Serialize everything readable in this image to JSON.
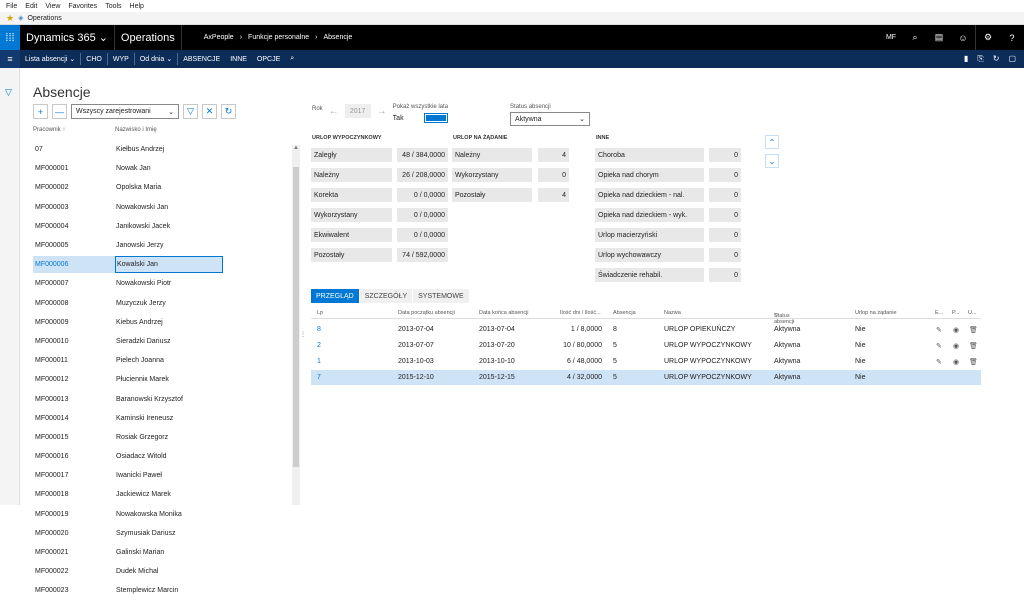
{
  "browser": {
    "menu": [
      "File",
      "Edit",
      "View",
      "Favorites",
      "Tools",
      "Help"
    ],
    "fav_label": "Operations"
  },
  "app": {
    "brand": "Dynamics 365",
    "module": "Operations",
    "breadcrumb": [
      "AxPeople",
      "Funkcje personalne",
      "Absencje"
    ],
    "user": "MF"
  },
  "actions": {
    "items": [
      "Lista absencji",
      "CHO",
      "WYP",
      "Od dnia",
      "ABSENCJE",
      "INNE",
      "OPCJE"
    ]
  },
  "page": {
    "title": "Absencje"
  },
  "left": {
    "filter_value": "Wszyscy zarejestrowani",
    "col_worker": "Pracownik ↑",
    "col_name": "Nazwisko i Imię",
    "rows": [
      [
        "07",
        "Kiełbus Andrzej"
      ],
      [
        "MF000001",
        "Nowak Jan"
      ],
      [
        "MF000002",
        "Opolska Maria"
      ],
      [
        "MF000003",
        "Nowakowski Jan"
      ],
      [
        "MF000004",
        "Janikowski Jacek"
      ],
      [
        "MF000005",
        "Janowski Jerzy"
      ],
      [
        "MF000006",
        "Kowalski Jan"
      ],
      [
        "MF000007",
        "Nowakowski Piotr"
      ],
      [
        "MF000008",
        "Muzyczuk Jerzy"
      ],
      [
        "MF000009",
        "Kiebus Andrzej"
      ],
      [
        "MF000010",
        "Sieradzki Dariusz"
      ],
      [
        "MF000011",
        "Pielech Joanna"
      ],
      [
        "MF000012",
        "Płucienniк Marek"
      ],
      [
        "MF000013",
        "Baranowski Krzysztof"
      ],
      [
        "MF000014",
        "Kaminski Ireneusz"
      ],
      [
        "MF000015",
        "Rosiak Grzegorz"
      ],
      [
        "MF000016",
        "Osiadacz Witold"
      ],
      [
        "MF000017",
        "Iwanicki Paweł"
      ],
      [
        "MF000018",
        "Jackiewicz Marek"
      ],
      [
        "MF000019",
        "Nowakowska Monika"
      ],
      [
        "MF000020",
        "Szymusiak Dariusz"
      ],
      [
        "MF000021",
        "Galinski Marian"
      ],
      [
        "MF000022",
        "Dudek Michal"
      ],
      [
        "MF000023",
        "Stemplewicz Marcin"
      ]
    ],
    "selected_index": 6
  },
  "header": {
    "rok_label": "Rok",
    "year": "2017",
    "show_all_label": "Pokaż wszystkie lata",
    "show_all_value": "Tak",
    "status_label": "Status absencji",
    "status_value": "Aktywna"
  },
  "groups": {
    "wyp": "URLOP WYPOCZYNKOWY",
    "zad": "URLOP NA ŻĄDANIE",
    "inne": "INNE"
  },
  "wyp": [
    [
      "Zaległy",
      "48 / 384,0000"
    ],
    [
      "Należny",
      "26 / 208,0000"
    ],
    [
      "Korekta",
      "0 / 0,0000"
    ],
    [
      "Wykorzystany",
      "0 / 0,0000"
    ],
    [
      "Ekwiwalent",
      "0 / 0,0000"
    ],
    [
      "Pozostały",
      "74 / 592,0000"
    ]
  ],
  "zad": [
    [
      "Należny",
      "4"
    ],
    [
      "Wykorzystany",
      "0"
    ],
    [
      "Pozostały",
      "4"
    ]
  ],
  "inne": [
    [
      "Choroba",
      "0"
    ],
    [
      "Opieka nad chorym",
      "0"
    ],
    [
      "Opieka nad dzieckiem - nal.",
      "0"
    ],
    [
      "Opieka nad dzieckiem - wyk.",
      "0"
    ],
    [
      "Urlop macierzyński",
      "0"
    ],
    [
      "Urlop wychowawczy",
      "0"
    ],
    [
      "Świadczenie rehabil.",
      "0"
    ]
  ],
  "tabs": [
    "PRZEGLĄD",
    "SZCZEGÓŁY",
    "SYSTEMOWE"
  ],
  "grid": {
    "cols": [
      "Lp",
      "Data początku absencji",
      "Data końca absencji",
      "Ilość dni / Ilość...",
      "Absencja",
      "Nazwa",
      "Status absencji",
      "Urlop na żądanie",
      "E...",
      "P...",
      "U..."
    ],
    "rows": [
      [
        "8",
        "2013-07-04",
        "2013-07-04",
        "1 / 8,0000",
        "8",
        "URLOP OPIEKUŃCZY",
        "Aktywna",
        "Nie"
      ],
      [
        "2",
        "2013-07-07",
        "2013-07-20",
        "10 / 80,0000",
        "5",
        "URLOP WYPOCZYNKOWY",
        "Aktywna",
        "Nie"
      ],
      [
        "1",
        "2013-10-03",
        "2013-10-10",
        "6 / 48,0000",
        "5",
        "URLOP WYPOCZYNKOWY",
        "Aktywna",
        "Nie"
      ],
      [
        "7",
        "2015-12-10",
        "2015-12-15",
        "4 / 32,0000",
        "5",
        "URLOP WYPOCZYNKOWY",
        "Aktywna",
        "Nie"
      ]
    ]
  }
}
